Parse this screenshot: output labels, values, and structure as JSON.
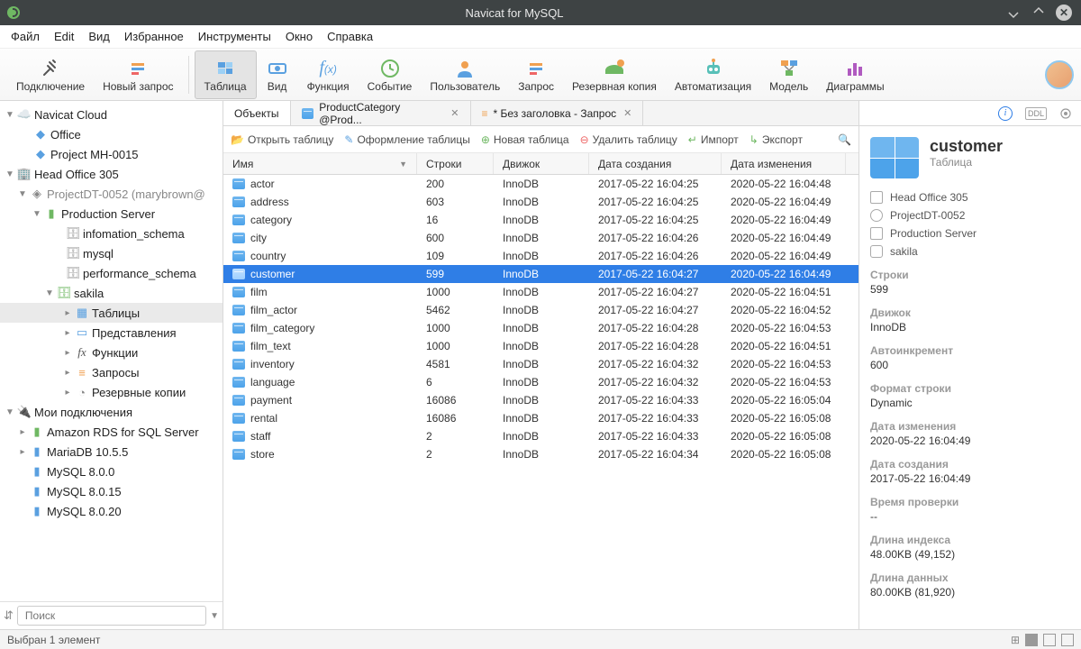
{
  "window": {
    "title": "Navicat for MySQL"
  },
  "menu": {
    "items": [
      "Файл",
      "Edit",
      "Вид",
      "Избранное",
      "Инструменты",
      "Окно",
      "Справка"
    ]
  },
  "toolbar": {
    "items": [
      {
        "label": "Подключение"
      },
      {
        "label": "Новый запрос"
      },
      {
        "label": "Таблица",
        "active": true
      },
      {
        "label": "Вид"
      },
      {
        "label": "Функция"
      },
      {
        "label": "Событие"
      },
      {
        "label": "Пользователь"
      },
      {
        "label": "Запрос"
      },
      {
        "label": "Резервная копия"
      },
      {
        "label": "Автоматизация"
      },
      {
        "label": "Модель"
      },
      {
        "label": "Диаграммы"
      }
    ]
  },
  "tree": {
    "navicat_cloud": "Navicat Cloud",
    "office": "Office",
    "project_mh": "Project MH-0015",
    "head_office": "Head Office 305",
    "project_dt": "ProjectDT-0052 (marybrown@",
    "prod_server": "Production Server",
    "info_schema": "infomation_schema",
    "mysql": "mysql",
    "perf_schema": "performance_schema",
    "sakila": "sakila",
    "tables": "Таблицы",
    "views": "Представления",
    "functions": "Функции",
    "queries": "Запросы",
    "backups": "Резервные копии",
    "my_conns": "Мои подключения",
    "rds": "Amazon RDS for SQL Server",
    "mariadb": "MariaDB 10.5.5",
    "mysql800": "MySQL 8.0.0",
    "mysql8015": "MySQL 8.0.15",
    "mysql8020": "MySQL 8.0.20"
  },
  "search_placeholder": "Поиск",
  "tabs": {
    "objects": "Объекты",
    "t2": "ProductCategory @Prod...",
    "t3": "* Без заголовка - Запрос"
  },
  "actionbar": {
    "open": "Открыть таблицу",
    "design": "Оформление таблицы",
    "new": "Новая таблица",
    "delete": "Удалить таблицу",
    "import": "Импорт",
    "export": "Экспорт"
  },
  "columns": {
    "name": "Имя",
    "rows": "Строки",
    "engine": "Движок",
    "created": "Дата создания",
    "modified": "Дата изменения"
  },
  "rows": [
    {
      "name": "actor",
      "rows": "200",
      "engine": "InnoDB",
      "created": "2017-05-22 16:04:25",
      "modified": "2020-05-22 16:04:48"
    },
    {
      "name": "address",
      "rows": "603",
      "engine": "InnoDB",
      "created": "2017-05-22 16:04:25",
      "modified": "2020-05-22 16:04:49"
    },
    {
      "name": "category",
      "rows": "16",
      "engine": "InnoDB",
      "created": "2017-05-22 16:04:25",
      "modified": "2020-05-22 16:04:49"
    },
    {
      "name": "city",
      "rows": "600",
      "engine": "InnoDB",
      "created": "2017-05-22 16:04:26",
      "modified": "2020-05-22 16:04:49"
    },
    {
      "name": "country",
      "rows": "109",
      "engine": "InnoDB",
      "created": "2017-05-22 16:04:26",
      "modified": "2020-05-22 16:04:49"
    },
    {
      "name": "customer",
      "rows": "599",
      "engine": "InnoDB",
      "created": "2017-05-22 16:04:27",
      "modified": "2020-05-22 16:04:49",
      "selected": true
    },
    {
      "name": "film",
      "rows": "1000",
      "engine": "InnoDB",
      "created": "2017-05-22 16:04:27",
      "modified": "2020-05-22 16:04:51"
    },
    {
      "name": "film_actor",
      "rows": "5462",
      "engine": "InnoDB",
      "created": "2017-05-22 16:04:27",
      "modified": "2020-05-22 16:04:52"
    },
    {
      "name": "film_category",
      "rows": "1000",
      "engine": "InnoDB",
      "created": "2017-05-22 16:04:28",
      "modified": "2020-05-22 16:04:53"
    },
    {
      "name": "film_text",
      "rows": "1000",
      "engine": "InnoDB",
      "created": "2017-05-22 16:04:28",
      "modified": "2020-05-22 16:04:51"
    },
    {
      "name": "inventory",
      "rows": "4581",
      "engine": "InnoDB",
      "created": "2017-05-22 16:04:32",
      "modified": "2020-05-22 16:04:53"
    },
    {
      "name": "language",
      "rows": "6",
      "engine": "InnoDB",
      "created": "2017-05-22 16:04:32",
      "modified": "2020-05-22 16:04:53"
    },
    {
      "name": "payment",
      "rows": "16086",
      "engine": "InnoDB",
      "created": "2017-05-22 16:04:33",
      "modified": "2020-05-22 16:05:04"
    },
    {
      "name": "rental",
      "rows": "16086",
      "engine": "InnoDB",
      "created": "2017-05-22 16:04:33",
      "modified": "2020-05-22 16:05:08"
    },
    {
      "name": "staff",
      "rows": "2",
      "engine": "InnoDB",
      "created": "2017-05-22 16:04:33",
      "modified": "2020-05-22 16:05:08"
    },
    {
      "name": "store",
      "rows": "2",
      "engine": "InnoDB",
      "created": "2017-05-22 16:04:34",
      "modified": "2020-05-22 16:05:08"
    }
  ],
  "info": {
    "title": "customer",
    "sub": "Таблица",
    "crumbs": [
      "Head Office 305",
      "ProjectDT-0052",
      "Production Server",
      "sakila"
    ],
    "props": [
      {
        "label": "Строки",
        "value": "599"
      },
      {
        "label": "Движок",
        "value": "InnoDB"
      },
      {
        "label": "Автоинкремент",
        "value": "600"
      },
      {
        "label": "Формат строки",
        "value": "Dynamic"
      },
      {
        "label": "Дата изменения",
        "value": "2020-05-22 16:04:49"
      },
      {
        "label": "Дата создания",
        "value": "2017-05-22 16:04:49"
      },
      {
        "label": "Время проверки",
        "value": "--"
      },
      {
        "label": "Длина индекса",
        "value": "48.00KB (49,152)"
      },
      {
        "label": "Длина данных",
        "value": "80.00KB (81,920)"
      }
    ]
  },
  "status": {
    "text": "Выбран 1 элемент"
  }
}
